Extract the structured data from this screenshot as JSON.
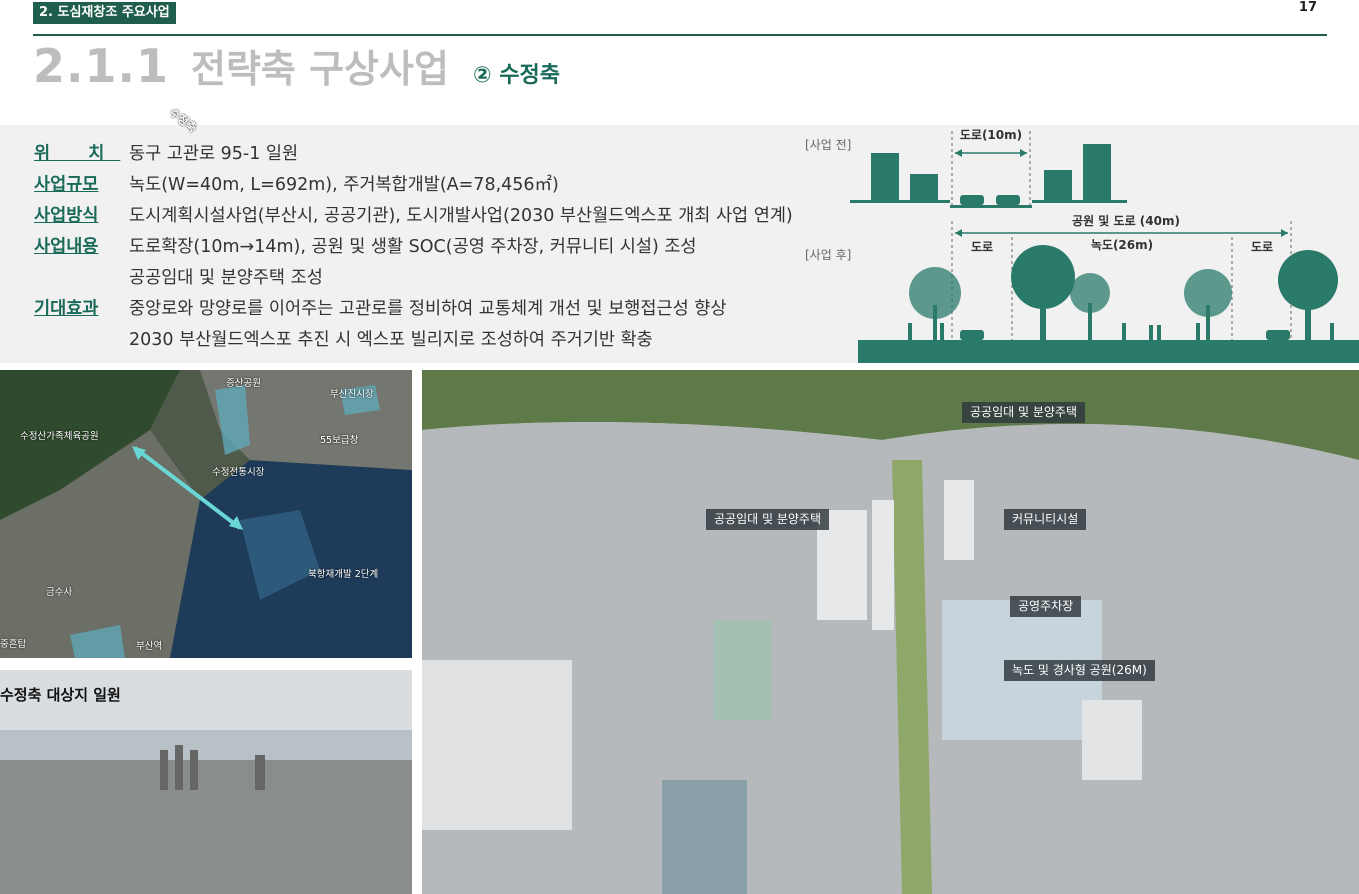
{
  "header": {
    "section_tag": "2. 도심재창조 주요사업",
    "page_number": "17",
    "title_number": "2.1.1",
    "title_text": "전략축 구상사업",
    "title_sub": "② 수정축"
  },
  "info": {
    "location_label": "위   치",
    "location_value": "동구 고관로 95-1 일원",
    "scale_label": "사업규모",
    "scale_value": "녹도(W=40m, L=692m), 주거복합개발(A=78,456㎡)",
    "method_label": "사업방식",
    "method_value": "도시계획시설사업(부산시, 공공기관), 도시개발사업(2030 부산월드엑스포 개최 사업 연계)",
    "content_label": "사업내용",
    "content_values": [
      "도로확장(10m→14m), 공원 및 생활 SOC(공영 주차장, 커뮤니티 시설) 조성",
      "공공임대 및 분양주택 조성"
    ],
    "effect_label": "기대효과",
    "effect_values": [
      "중앙로와 망양로를 이어주는 고관로를 정비하여 교통체계 개선 및 보행접근성 향상",
      "2030 부산월드엑스포 추진 시 엑스포 빌리지로 조성하여 주거기반 확충"
    ]
  },
  "diagram": {
    "before_label": "[사업 전]",
    "after_label": "[사업 후]",
    "road_before": "도로(10m)",
    "park_road": "공원 및 도로 (40m)",
    "road_left": "도로",
    "green_way": "녹도(26m)",
    "road_right": "도로",
    "accent_color": "#2a7a6a"
  },
  "map": {
    "route_label": "수정축",
    "places": [
      "증산공원",
      "부산진시장",
      "수정산가족체육공원",
      "55보급창",
      "수정전통시장",
      "북항재개발 2단계",
      "금수사",
      "중흔탑",
      "부산역"
    ]
  },
  "photo": {
    "caption": "수정축 대상지 일원"
  },
  "render": {
    "labels": [
      "공공임대 및 분양주택",
      "공공임대 및 분양주택",
      "커뮤니티시설",
      "공영주차장",
      "녹도 및 경사형 공원(26M)"
    ]
  }
}
